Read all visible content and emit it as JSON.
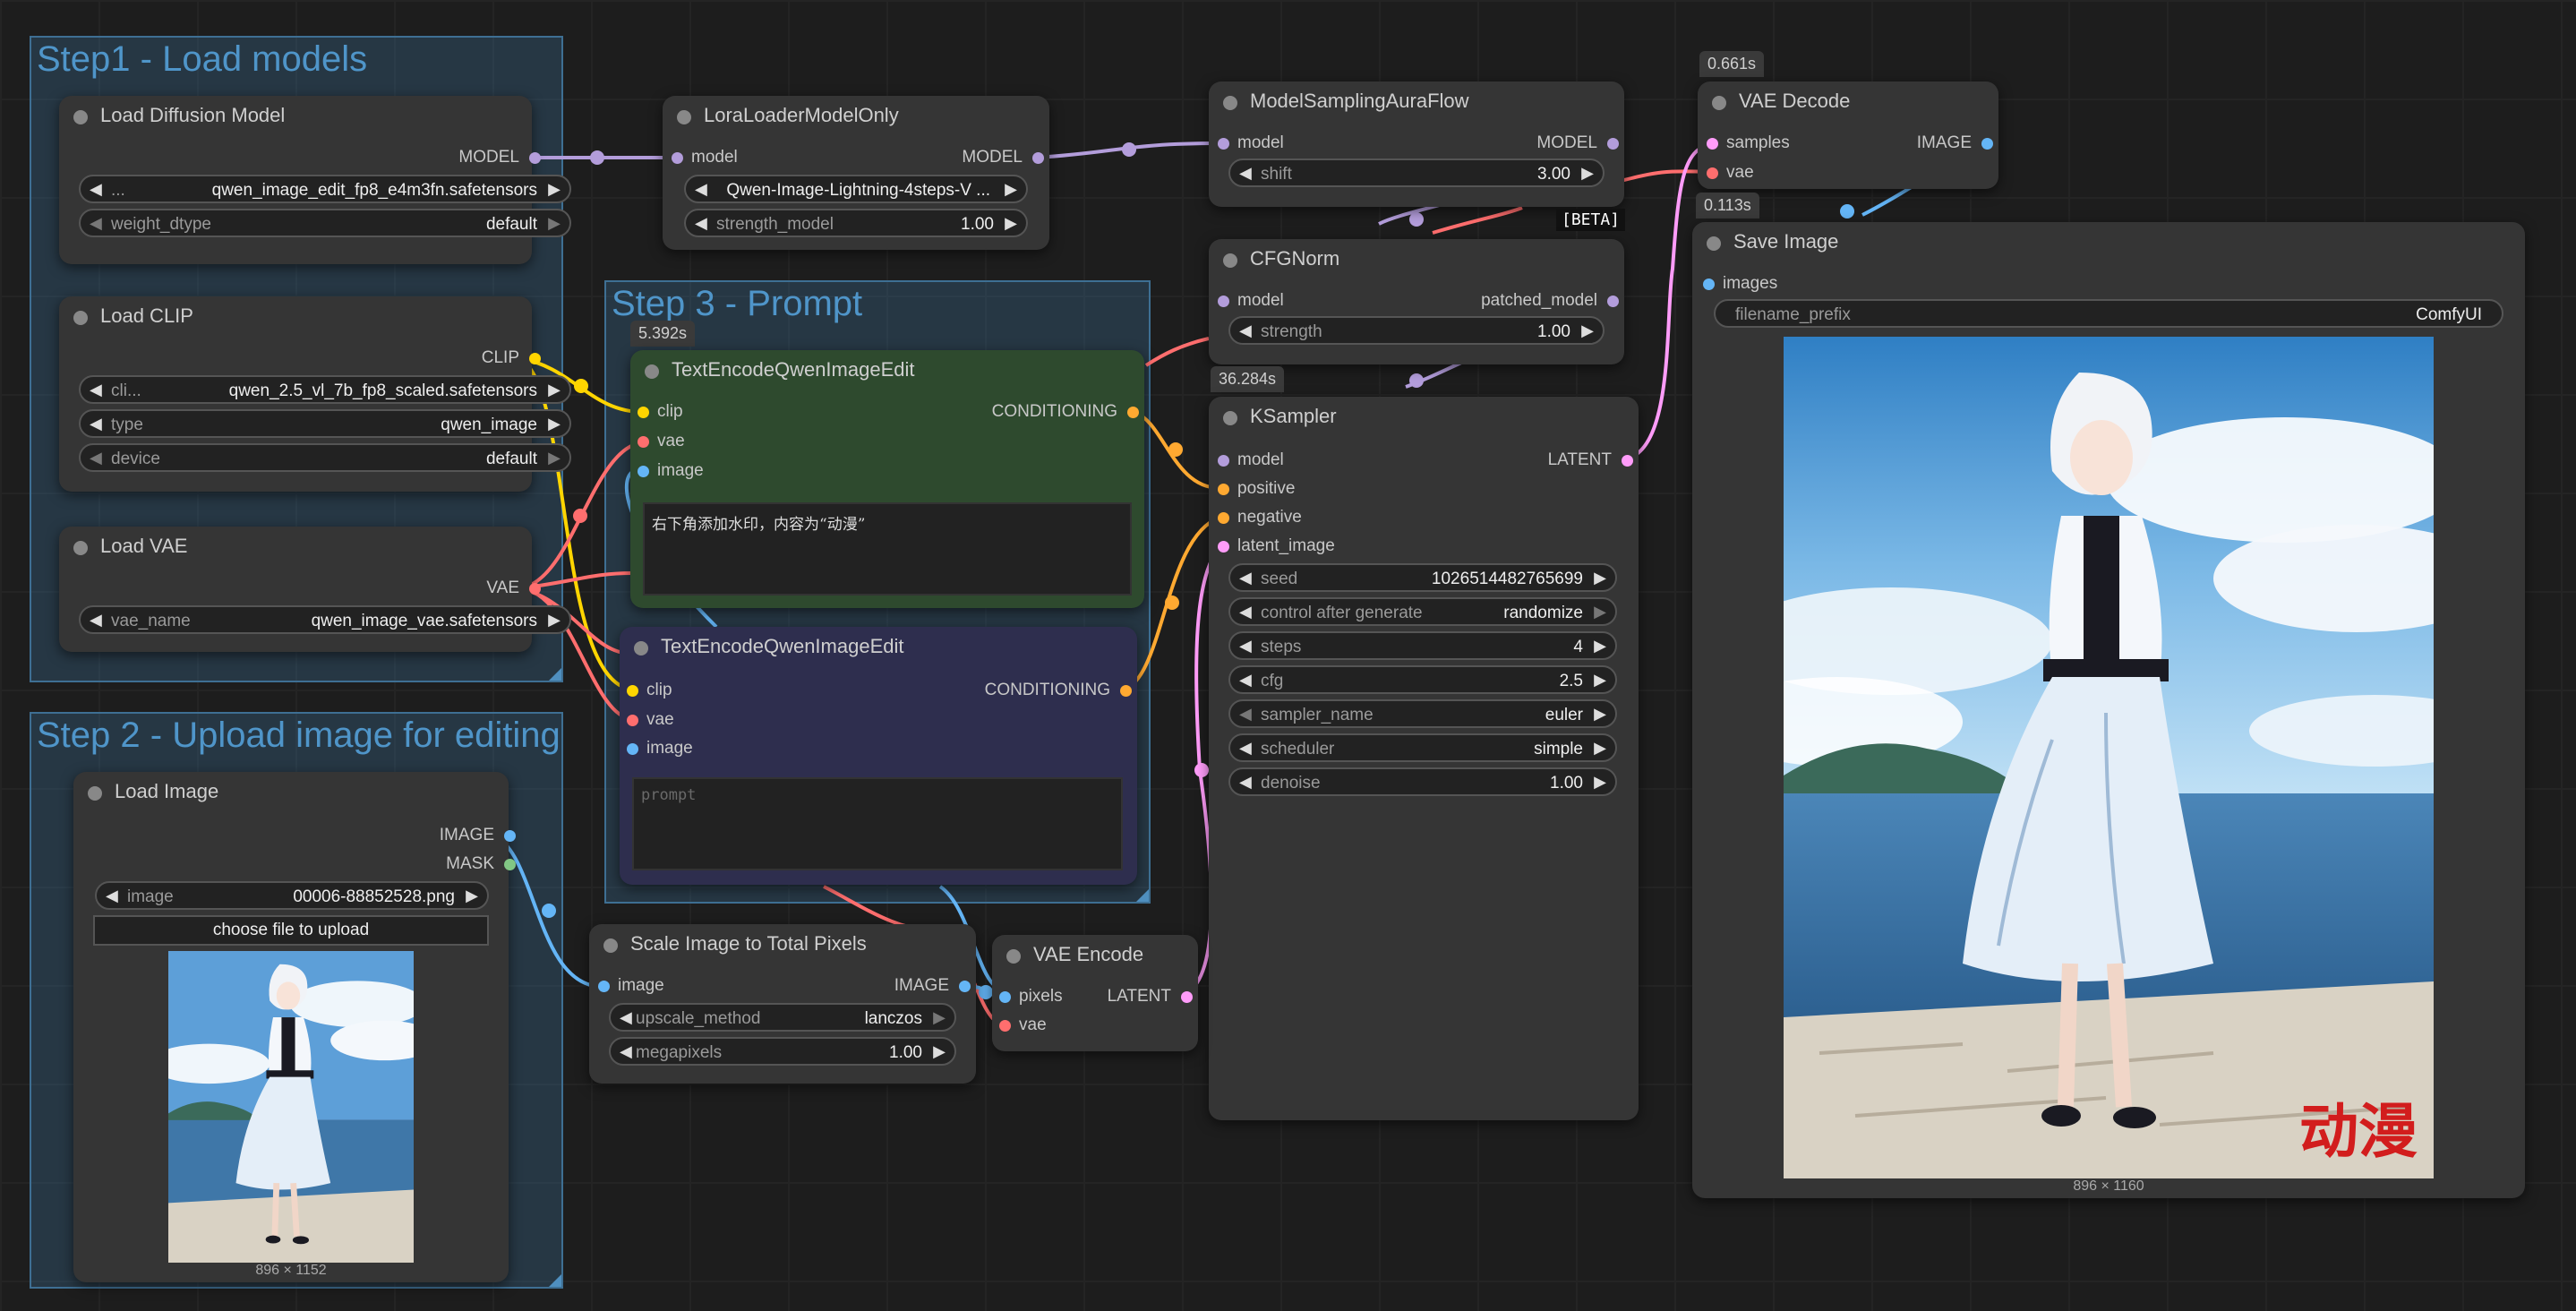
{
  "groups": {
    "step1": "Step1 - Load models",
    "step2": "Step 2 - Upload image for editing",
    "step3": "Step 3 - Prompt"
  },
  "nodes": {
    "load_diffusion": {
      "title": "Load Diffusion Model",
      "out_model": "MODEL",
      "unet_label": "...",
      "unet_value": "qwen_image_edit_fp8_e4m3fn.safetensors",
      "dtype_label": "weight_dtype",
      "dtype_value": "default"
    },
    "load_clip": {
      "title": "Load CLIP",
      "out_clip": "CLIP",
      "clip_label": "cli...",
      "clip_value": "qwen_2.5_vl_7b_fp8_scaled.safetensors",
      "type_label": "type",
      "type_value": "qwen_image",
      "device_label": "device",
      "device_value": "default"
    },
    "load_vae": {
      "title": "Load VAE",
      "out_vae": "VAE",
      "vae_label": "vae_name",
      "vae_value": "qwen_image_vae.safetensors"
    },
    "lora": {
      "title": "LoraLoaderModelOnly",
      "in_model": "model",
      "out_model": "MODEL",
      "lora_value": "Qwen-Image-Lightning-4steps-V ...",
      "strength_label": "strength_model",
      "strength_value": "1.00"
    },
    "aura": {
      "title": "ModelSamplingAuraFlow",
      "in_model": "model",
      "out_model": "MODEL",
      "shift_label": "shift",
      "shift_value": "3.00"
    },
    "cfgnorm": {
      "title": "CFGNorm",
      "beta": "[BETA]",
      "in_model": "model",
      "out_model": "patched_model",
      "strength_label": "strength",
      "strength_value": "1.00"
    },
    "vae_decode": {
      "title": "VAE Decode",
      "time": "0.661s",
      "in_samples": "samples",
      "in_vae": "vae",
      "out_image": "IMAGE"
    },
    "save_image": {
      "title": "Save Image",
      "time": "0.113s",
      "in_images": "images",
      "prefix_label": "filename_prefix",
      "prefix_value": "ComfyUI",
      "watermark": "动漫",
      "caption": "896 × 1160"
    },
    "text_pos": {
      "title": "TextEncodeQwenImageEdit",
      "time": "5.392s",
      "in_clip": "clip",
      "in_vae": "vae",
      "in_image": "image",
      "out_cond": "CONDITIONING",
      "prompt": "右下角添加水印，内容为“动漫”"
    },
    "text_neg": {
      "title": "TextEncodeQwenImageEdit",
      "in_clip": "clip",
      "in_vae": "vae",
      "in_image": "image",
      "out_cond": "CONDITIONING",
      "placeholder": "prompt"
    },
    "ksampler": {
      "title": "KSampler",
      "time": "36.284s",
      "in_model": "model",
      "in_positive": "positive",
      "in_negative": "negative",
      "in_latent": "latent_image",
      "out_latent": "LATENT",
      "widgets": [
        {
          "label": "seed",
          "value": "1026514482765699"
        },
        {
          "label": "control after generate",
          "value": "randomize"
        },
        {
          "label": "steps",
          "value": "4"
        },
        {
          "label": "cfg",
          "value": "2.5"
        },
        {
          "label": "sampler_name",
          "value": "euler"
        },
        {
          "label": "scheduler",
          "value": "simple"
        },
        {
          "label": "denoise",
          "value": "1.00"
        }
      ]
    },
    "load_image": {
      "title": "Load Image",
      "out_image": "IMAGE",
      "out_mask": "MASK",
      "image_label": "image",
      "image_value": "00006-88852528.png",
      "upload_label": "choose file to upload",
      "caption": "896 × 1152"
    },
    "scale": {
      "title": "Scale Image to Total Pixels",
      "in_image": "image",
      "out_image": "IMAGE",
      "method_label": "upscale_method",
      "method_value": "lanczos",
      "mp_label": "megapixels",
      "mp_value": "1.00"
    },
    "vae_encode": {
      "title": "VAE Encode",
      "in_pixels": "pixels",
      "in_vae": "vae",
      "out_latent": "LATENT"
    }
  },
  "colors": {
    "model": "#b39ddb",
    "clip": "#ffd500",
    "vae": "#ff6e6e",
    "conditioning": "#ffa931",
    "latent": "#ff9cf9",
    "image": "#64b5f6",
    "group_title": "#4f95c9",
    "positive_node": "#2e4a2e",
    "negative_node": "#2e2e4e"
  }
}
